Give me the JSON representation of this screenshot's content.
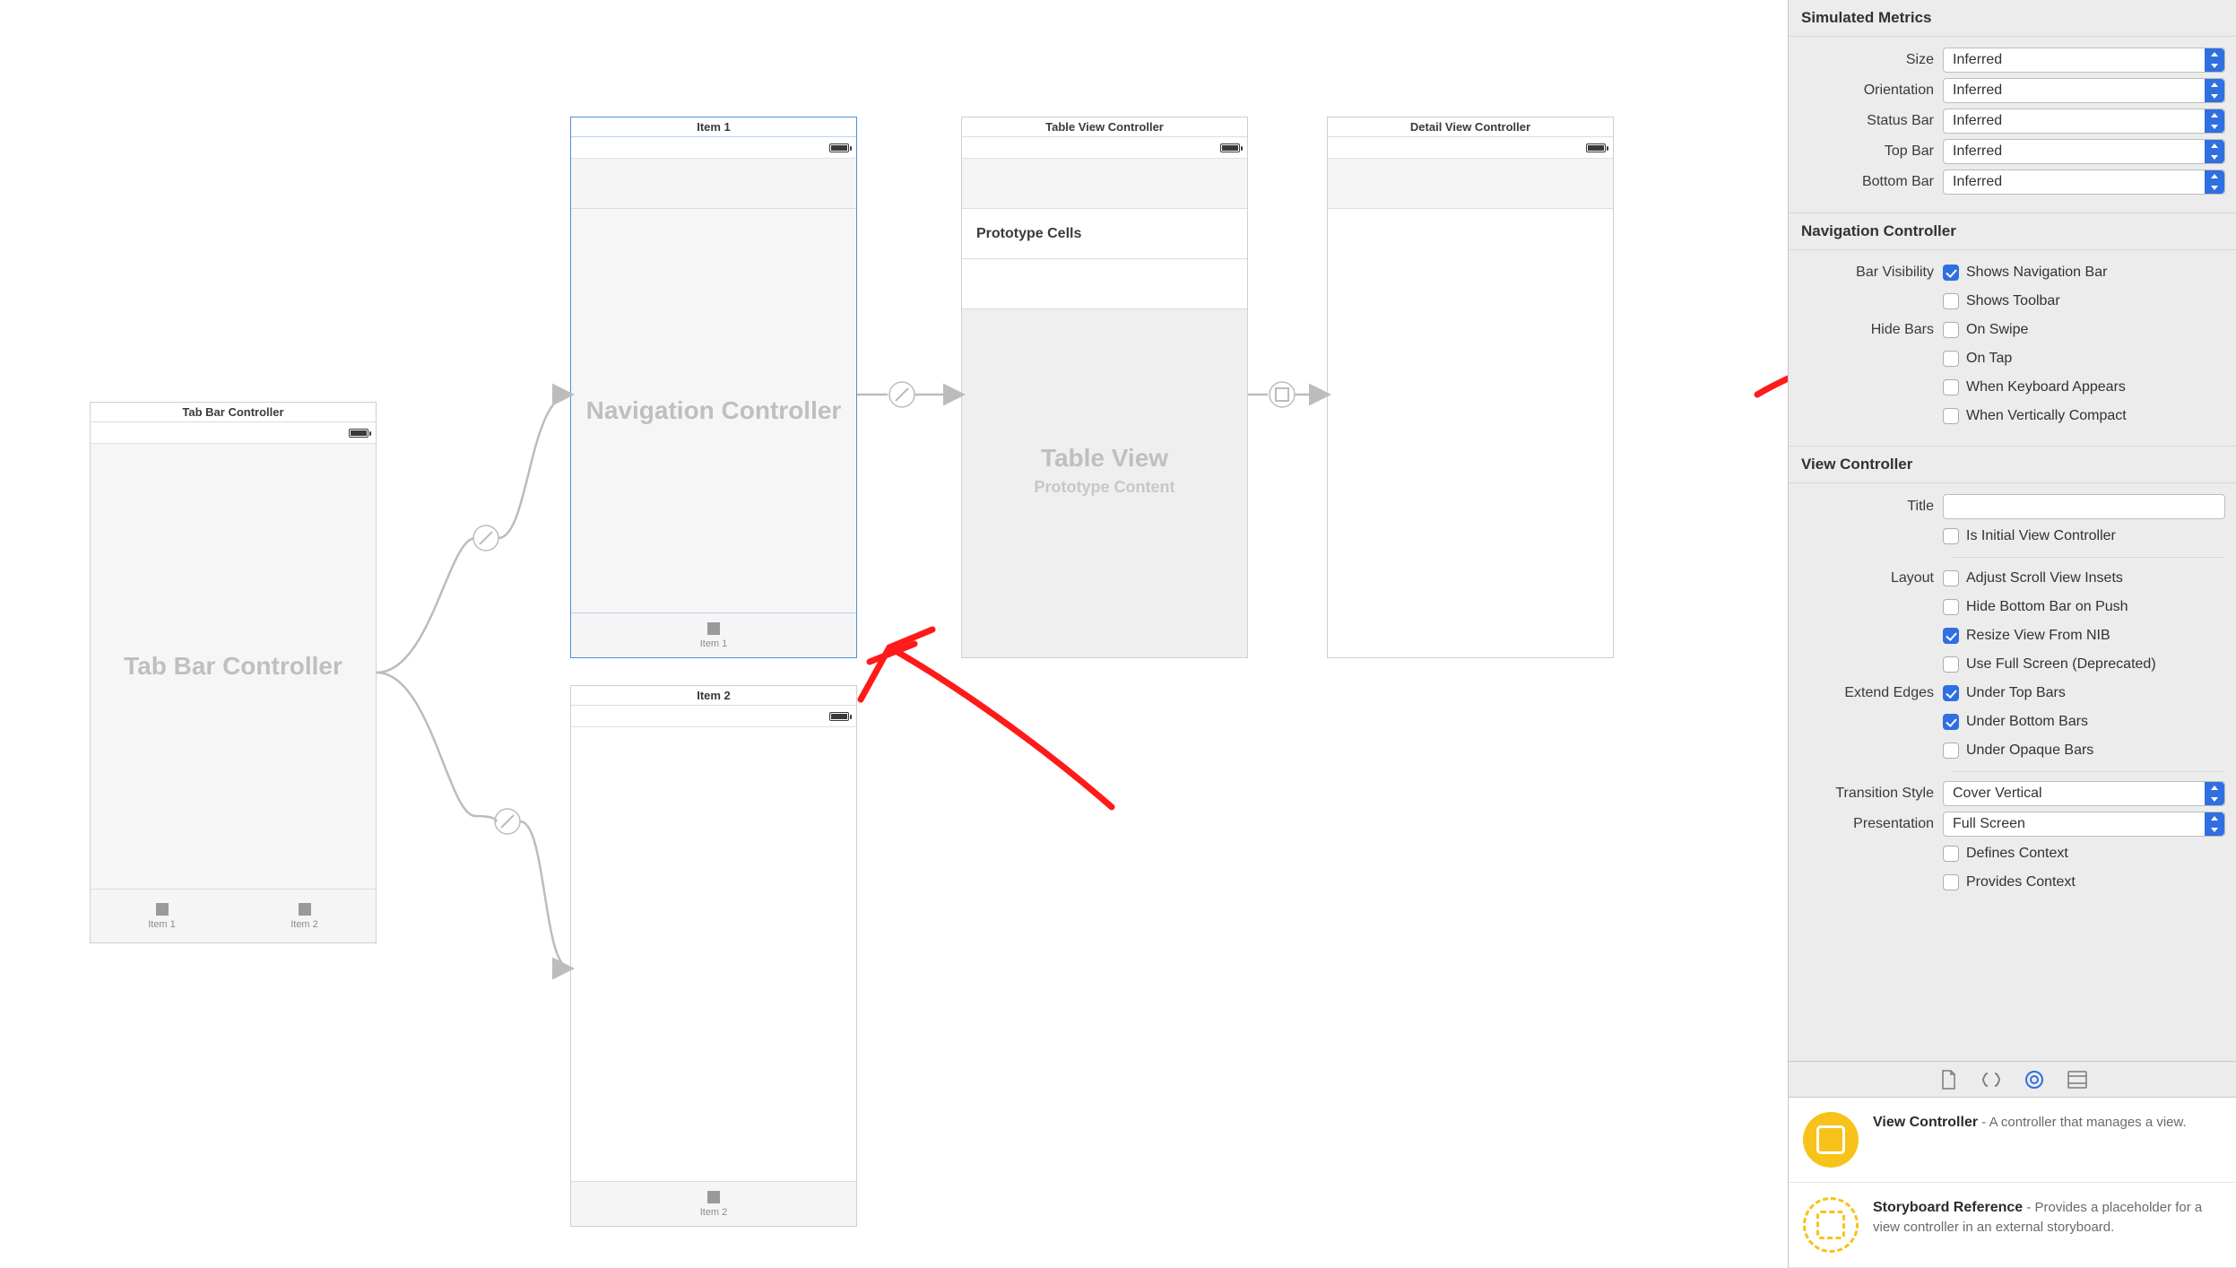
{
  "canvas": {
    "scene1": {
      "title": "Tab Bar Controller",
      "body_title": "Tab Bar Controller",
      "tabs": [
        "Item 1",
        "Item 2"
      ]
    },
    "scene2": {
      "title": "Item 1",
      "body_title": "Navigation Controller",
      "tab_label": "Item 1"
    },
    "scene3": {
      "title": "Item 2",
      "tab_label": "Item 2"
    },
    "scene4": {
      "title": "Table View Controller",
      "proto_label": "Prototype Cells",
      "body_title": "Table View",
      "body_sub": "Prototype Content"
    },
    "scene5": {
      "title": "Detail View Controller"
    }
  },
  "inspector": {
    "sim_metrics": {
      "header": "Simulated Metrics",
      "rows": [
        {
          "label": "Size",
          "value": "Inferred"
        },
        {
          "label": "Orientation",
          "value": "Inferred"
        },
        {
          "label": "Status Bar",
          "value": "Inferred"
        },
        {
          "label": "Top Bar",
          "value": "Inferred"
        },
        {
          "label": "Bottom Bar",
          "value": "Inferred"
        }
      ]
    },
    "nav_ctrl": {
      "header": "Navigation Controller",
      "bar_vis_label": "Bar Visibility",
      "bar_vis": [
        {
          "checked": true,
          "label": "Shows Navigation Bar"
        },
        {
          "checked": false,
          "label": "Shows Toolbar"
        }
      ],
      "hide_bars_label": "Hide Bars",
      "hide_bars": [
        {
          "checked": false,
          "label": "On Swipe"
        },
        {
          "checked": false,
          "label": "On Tap"
        },
        {
          "checked": false,
          "label": "When Keyboard Appears"
        },
        {
          "checked": false,
          "label": "When Vertically Compact"
        }
      ]
    },
    "view_ctrl": {
      "header": "View Controller",
      "title_label": "Title",
      "title_value": "",
      "initial": {
        "checked": false,
        "label": "Is Initial View Controller"
      },
      "layout_label": "Layout",
      "layout": [
        {
          "checked": false,
          "label": "Adjust Scroll View Insets"
        },
        {
          "checked": false,
          "label": "Hide Bottom Bar on Push"
        },
        {
          "checked": true,
          "label": "Resize View From NIB"
        },
        {
          "checked": false,
          "label": "Use Full Screen (Deprecated)"
        }
      ],
      "extend_label": "Extend Edges",
      "extend": [
        {
          "checked": true,
          "label": "Under Top Bars"
        },
        {
          "checked": true,
          "label": "Under Bottom Bars"
        },
        {
          "checked": false,
          "label": "Under Opaque Bars"
        }
      ],
      "transition_label": "Transition Style",
      "transition_value": "Cover Vertical",
      "presentation_label": "Presentation",
      "presentation_value": "Full Screen",
      "defines_context": {
        "checked": false,
        "label": "Defines Context"
      },
      "provides_context": {
        "checked": false,
        "label": "Provides Context"
      }
    },
    "library": {
      "vc_title": "View Controller",
      "vc_desc": " - A controller that manages a view.",
      "sr_title": "Storyboard Reference",
      "sr_desc": " - Provides a placeholder for a view controller in an external storyboard."
    }
  }
}
